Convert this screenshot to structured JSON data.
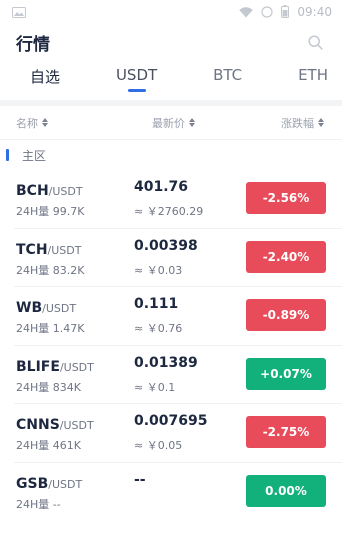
{
  "status_bar": {
    "time": "09:40",
    "icons": [
      "image-icon",
      "wifi-icon",
      "signal-icon",
      "battery-icon"
    ]
  },
  "header": {
    "title": "行情"
  },
  "tabs": [
    {
      "label": "自选"
    },
    {
      "label": "USDT"
    },
    {
      "label": "BTC"
    },
    {
      "label": "ETH"
    }
  ],
  "columns": {
    "name": "名称",
    "price": "最新价",
    "change": "涨跌幅"
  },
  "section": {
    "title": "主区"
  },
  "colors": {
    "accent": "#2f6fe4",
    "down": "#e84c5a",
    "up": "#12b07a"
  },
  "rows": [
    {
      "symbol": "BCH",
      "quote": "/USDT",
      "volume": "24H量 99.7K",
      "price": "401.76",
      "cny": "≈ ￥2760.29",
      "change": "-2.56%",
      "direction": "down"
    },
    {
      "symbol": "TCH",
      "quote": "/USDT",
      "volume": "24H量 83.2K",
      "price": "0.00398",
      "cny": "≈ ￥0.03",
      "change": "-2.40%",
      "direction": "down"
    },
    {
      "symbol": "WB",
      "quote": "/USDT",
      "volume": "24H量 1.47K",
      "price": "0.111",
      "cny": "≈ ￥0.76",
      "change": "-0.89%",
      "direction": "down"
    },
    {
      "symbol": "BLIFE",
      "quote": "/USDT",
      "volume": "24H量 834K",
      "price": "0.01389",
      "cny": "≈ ￥0.1",
      "change": "+0.07%",
      "direction": "up"
    },
    {
      "symbol": "CNNS",
      "quote": "/USDT",
      "volume": "24H量 461K",
      "price": "0.007695",
      "cny": "≈ ￥0.05",
      "change": "-2.75%",
      "direction": "down"
    },
    {
      "symbol": "GSB",
      "quote": "/USDT",
      "volume": "24H量 --",
      "price": "--",
      "cny": "",
      "change": "0.00%",
      "direction": "up"
    }
  ]
}
